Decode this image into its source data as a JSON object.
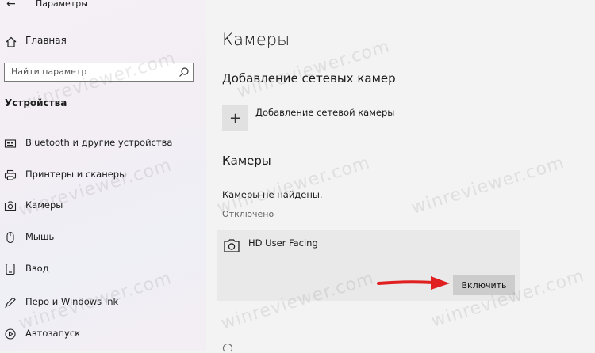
{
  "window": {
    "title": "Параметры"
  },
  "sidebar": {
    "home_label": "Главная",
    "search_placeholder": "Найти параметр",
    "section_title": "Устройства",
    "items": [
      {
        "label": "Bluetooth и другие устройства",
        "icon": "bluetooth-devices-icon"
      },
      {
        "label": "Принтеры и сканеры",
        "icon": "printer-icon"
      },
      {
        "label": "Камеры",
        "icon": "camera-icon"
      },
      {
        "label": "Мышь",
        "icon": "mouse-icon"
      },
      {
        "label": "Ввод",
        "icon": "keyboard-icon"
      },
      {
        "label": "Перо и Windows Ink",
        "icon": "pen-icon"
      },
      {
        "label": "Автозапуск",
        "icon": "autoplay-icon"
      }
    ]
  },
  "main": {
    "title": "Камеры",
    "network_section_title": "Добавление сетевых камер",
    "add_network_camera_label": "Добавление сетевой камеры",
    "cameras_section_title": "Камеры",
    "no_cameras_text": "Камеры не найдены.",
    "disabled_label": "Отключено",
    "camera": {
      "name": "HD User Facing",
      "enable_button": "Включить"
    }
  },
  "watermark": "winreviewer.com",
  "colors": {
    "arrow": "#e02020",
    "card_bg": "#e9e9e9",
    "button_bg": "#cccccc"
  }
}
